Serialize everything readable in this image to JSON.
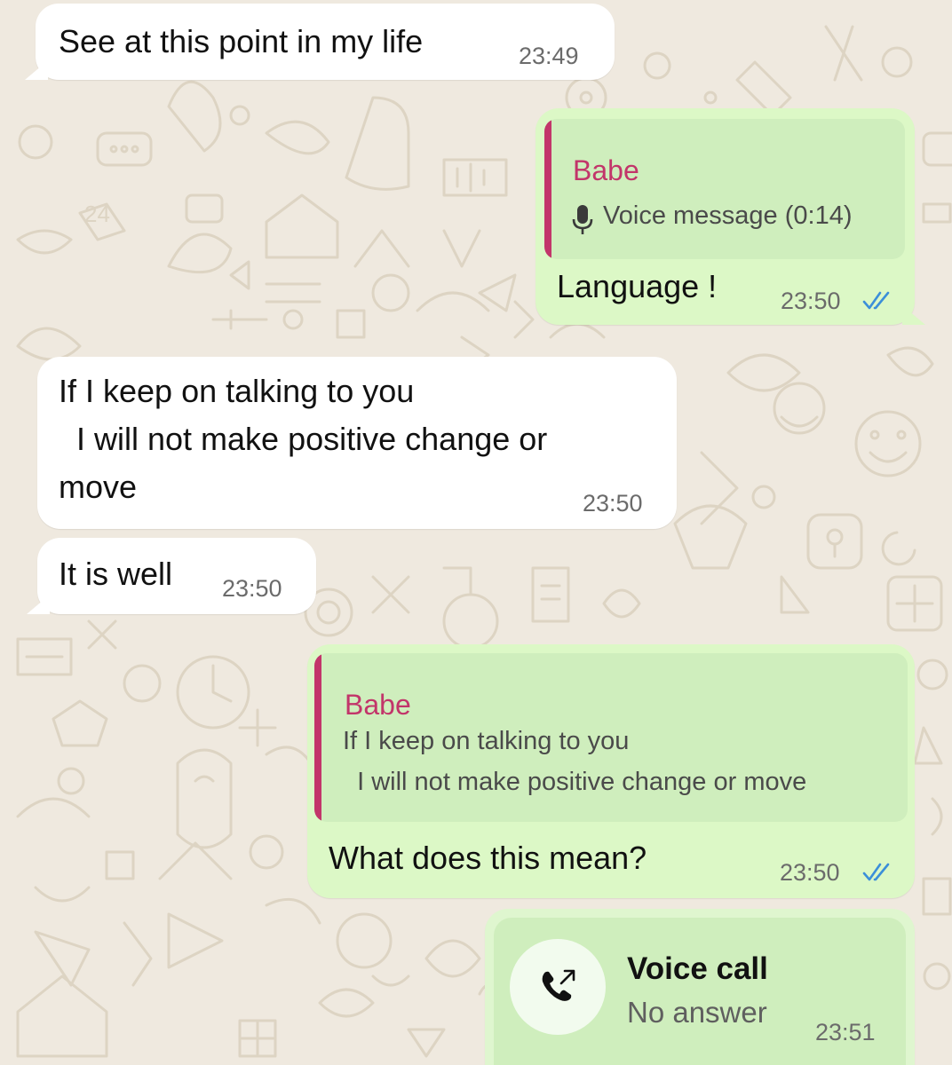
{
  "messages": [
    {
      "direction": "incoming",
      "text": "See at this point in my life",
      "time": "23:49"
    },
    {
      "direction": "outgoing",
      "reply_to": {
        "author": "Babe",
        "icon": "microphone-icon",
        "text": "Voice message (0:14)"
      },
      "text": "Language !",
      "time": "23:50",
      "status": "read-double-check-icon"
    },
    {
      "direction": "incoming",
      "text_lines": [
        "If I keep on talking to you",
        "  I will not make positive change or",
        "move"
      ],
      "time": "23:50"
    },
    {
      "direction": "incoming",
      "text": "It is well",
      "time": "23:50"
    },
    {
      "direction": "outgoing",
      "reply_to": {
        "author": "Babe",
        "text_lines": [
          "If I keep on talking to you",
          "  I will not make positive change or move"
        ]
      },
      "text": "What does this mean?",
      "time": "23:50",
      "status": "read-double-check-icon"
    },
    {
      "direction": "outgoing",
      "type": "call",
      "call": {
        "icon": "outgoing-call-icon",
        "title": "Voice call",
        "subtitle": "No answer"
      },
      "time": "23:51"
    }
  ],
  "colors": {
    "background": "#efe9df",
    "incoming_bubble": "#ffffff",
    "outgoing_bubble": "#dcf8c6",
    "quote_background": "#cfeebd",
    "quote_accent": "#c2356a",
    "read_ticks": "#3b8fd9"
  }
}
